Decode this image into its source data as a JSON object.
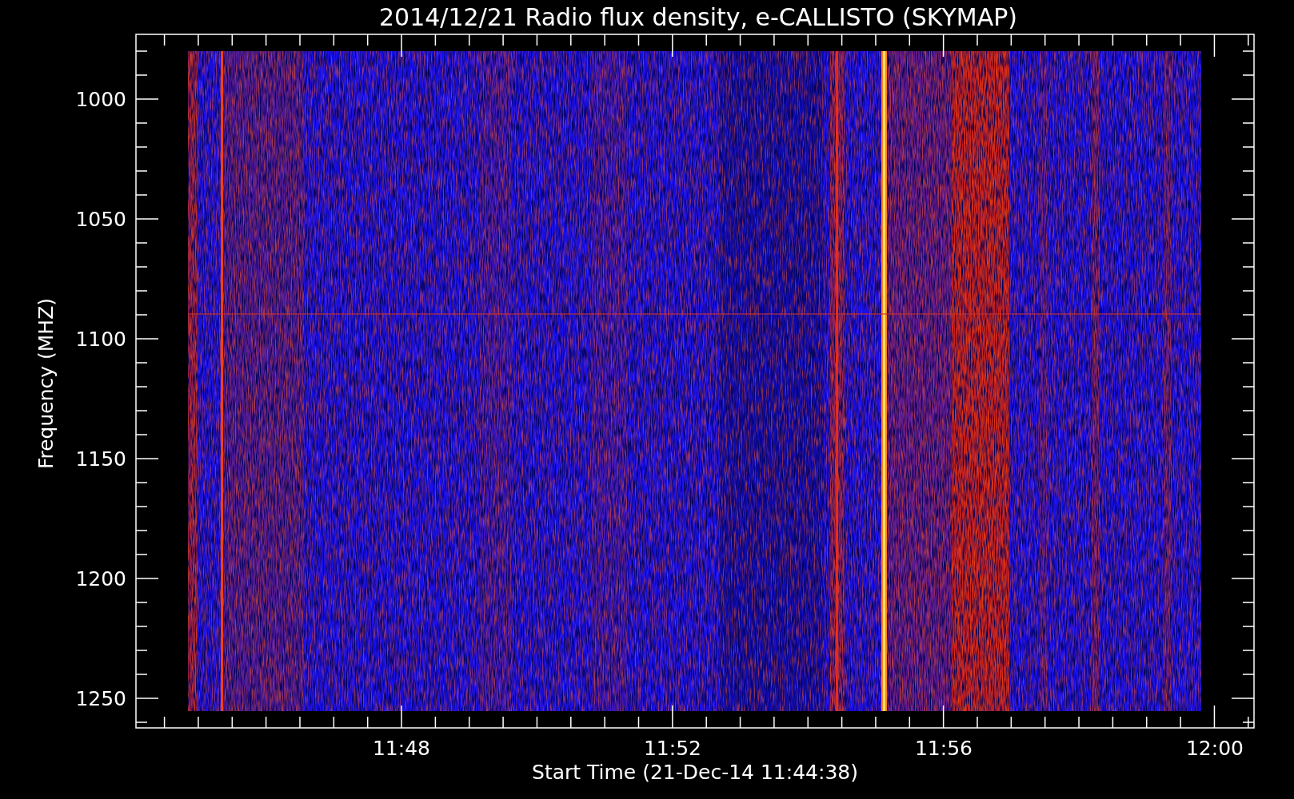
{
  "title": "2014/12/21  Radio flux density, e-CALLISTO (SKYMAP)",
  "y_axis": {
    "label": "Frequency (MHZ)",
    "ticks": [
      "1000",
      "1050",
      "1100",
      "1150",
      "1200",
      "1250"
    ]
  },
  "x_axis": {
    "label": "Start Time (21-Dec-14 11:44:38)",
    "ticks": [
      "11:48",
      "11:52",
      "11:56",
      "12:00"
    ]
  }
}
